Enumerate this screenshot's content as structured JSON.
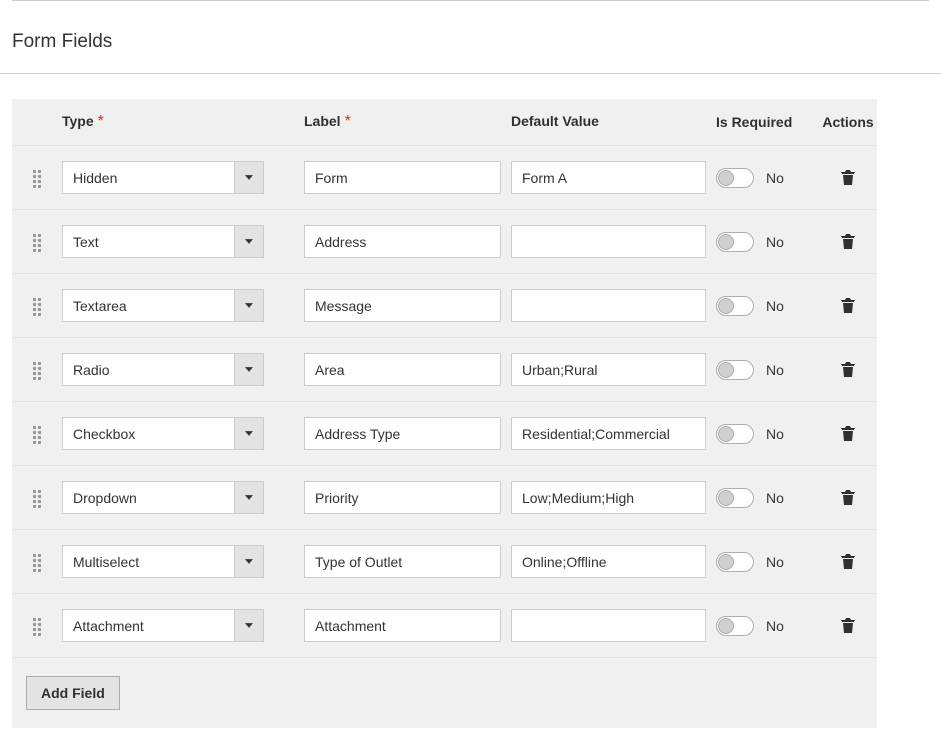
{
  "section_title": "Form Fields",
  "headers": {
    "type": "Type",
    "label": "Label",
    "default_value": "Default Value",
    "is_required": "Is Required",
    "actions": "Actions"
  },
  "required_mark": "*",
  "toggle_off_label": "No",
  "add_button_label": "Add Field",
  "rows": [
    {
      "type": "Hidden",
      "label": "Form",
      "default_value": "Form A",
      "required": false
    },
    {
      "type": "Text",
      "label": "Address",
      "default_value": "",
      "required": false
    },
    {
      "type": "Textarea",
      "label": "Message",
      "default_value": "",
      "required": false
    },
    {
      "type": "Radio",
      "label": "Area",
      "default_value": "Urban;Rural",
      "required": false
    },
    {
      "type": "Checkbox",
      "label": "Address Type",
      "default_value": "Residential;Commercial",
      "required": false
    },
    {
      "type": "Dropdown",
      "label": "Priority",
      "default_value": "Low;Medium;High",
      "required": false
    },
    {
      "type": "Multiselect",
      "label": "Type of Outlet",
      "default_value": "Online;Offline",
      "required": false
    },
    {
      "type": "Attachment",
      "label": "Attachment",
      "default_value": "",
      "required": false
    }
  ]
}
